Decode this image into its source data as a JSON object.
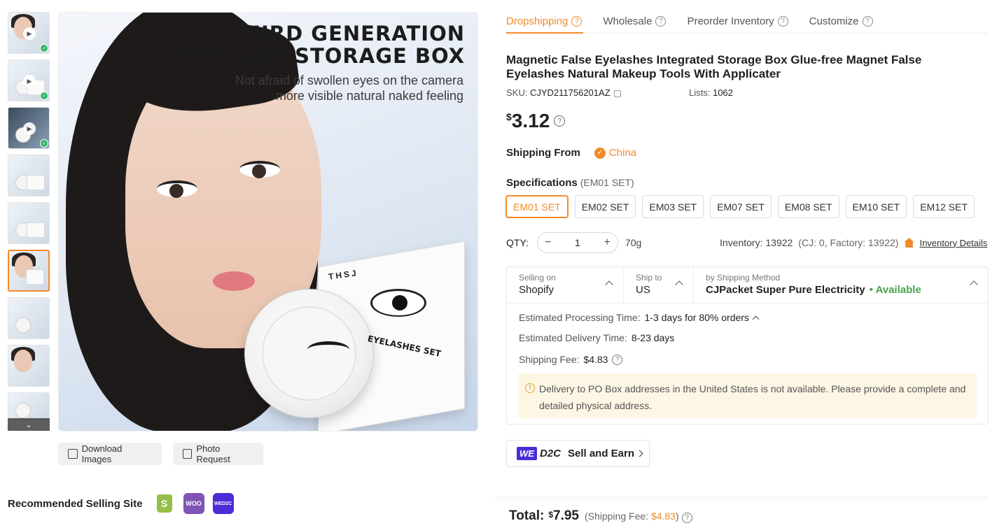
{
  "thumbnails": [
    {
      "kind": "video"
    },
    {
      "kind": "video"
    },
    {
      "kind": "video"
    },
    {
      "kind": "image"
    },
    {
      "kind": "image"
    },
    {
      "kind": "image",
      "selected": true
    },
    {
      "kind": "image"
    },
    {
      "kind": "image"
    },
    {
      "kind": "image"
    }
  ],
  "main_image": {
    "headline_line1": "THIRD GENERATION",
    "headline_line2": "EYELASH STORAGE BOX",
    "subline_line1": "Not afraid of swollen eyes on the camera",
    "subline_line2": "more visible natural naked feeling",
    "package_brand": "THSJ",
    "case_text": "EYELASHES SET"
  },
  "image_actions": {
    "download": "Download Images",
    "photo_request": "Photo Request"
  },
  "recommended": {
    "label": "Recommended Selling Site",
    "sites": [
      {
        "name": "shopify-icon",
        "text": "S"
      },
      {
        "name": "woo-icon",
        "text": "WOO"
      },
      {
        "name": "wed2c-icon",
        "text": "WED2C"
      }
    ]
  },
  "tabs": [
    {
      "label": "Dropshipping",
      "active": true
    },
    {
      "label": "Wholesale"
    },
    {
      "label": "Preorder Inventory"
    },
    {
      "label": "Customize"
    }
  ],
  "product": {
    "title": "Magnetic False Eyelashes Integrated Storage Box Glue-free Magnet False Eyelashes Natural Makeup Tools With Applicater",
    "sku_label": "SKU:",
    "sku": "CJYD211756201AZ",
    "lists_label": "Lists:",
    "lists": "1062",
    "currency": "$",
    "price": "3.12"
  },
  "shipping_from": {
    "label": "Shipping From",
    "value": "China"
  },
  "specifications": {
    "label": "Specifications",
    "current": "(EM01 SET)",
    "options": [
      "EM01 SET",
      "EM02 SET",
      "EM03 SET",
      "EM07 SET",
      "EM08 SET",
      "EM10 SET",
      "EM12 SET"
    ],
    "selected_index": 0
  },
  "quantity": {
    "label": "QTY:",
    "minus": "−",
    "value": "1",
    "plus": "+",
    "weight": "70g"
  },
  "inventory": {
    "text": "Inventory: 13922",
    "breakdown": "(CJ: 0, Factory: 13922)",
    "details_link": "Inventory Details"
  },
  "shipping": {
    "selling_on_caption": "Selling on",
    "selling_on": "Shopify",
    "ship_to_caption": "Ship to",
    "ship_to": "US",
    "method_caption": "by Shipping Method",
    "method": "CJPacket Super Pure Electricity",
    "availability": "• Available",
    "processing_label": "Estimated Processing Time:",
    "processing_value": "1-3 days for 80% orders",
    "delivery_label": "Estimated Delivery Time:",
    "delivery_value": "8-23 days",
    "fee_label": "Shipping Fee:",
    "fee_value": "$4.83",
    "notice": "Delivery to PO Box addresses in the United States is not available. Please provide a complete and detailed physical address."
  },
  "sell_earn": {
    "we": "WE",
    "d2c": "D2C",
    "label": "Sell and Earn"
  },
  "total": {
    "label": "Total:",
    "currency": "$",
    "value": "7.95",
    "fee_prefix": "(Shipping Fee: ",
    "fee_value": "$4.83",
    "fee_suffix": ")"
  },
  "colors": {
    "accent": "#f18a2a",
    "available": "#4ba24b",
    "notice_bg": "#fdf6e4"
  }
}
